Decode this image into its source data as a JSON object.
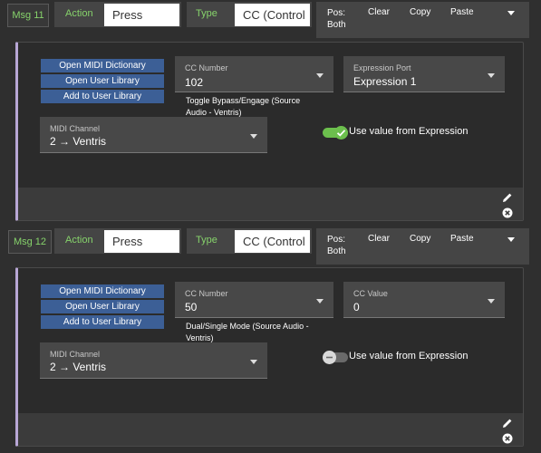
{
  "messages": [
    {
      "badge": "Msg 11",
      "action_label": "Action",
      "action_value": "Press",
      "type_label": "Type",
      "type_value": "CC (Control",
      "pos_label": "Pos:",
      "pos_value": "Both",
      "clear_label": "Clear",
      "copy_label": "Copy",
      "paste_label": "Paste",
      "library_buttons": [
        "Open MIDI Dictionary",
        "Open User Library",
        "Add to User Library"
      ],
      "cc_number_label": "CC Number",
      "cc_number_value": "102",
      "description": "Toggle Bypass/Engage (Source Audio - Ventris)",
      "second_field_label": "Expression Port",
      "second_field_value": "Expression 1",
      "midi_channel_label": "MIDI Channel",
      "midi_channel_value": "2 → Ventris",
      "toggle_label": "Use value from Expression",
      "toggle_on": true
    },
    {
      "badge": "Msg 12",
      "action_label": "Action",
      "action_value": "Press",
      "type_label": "Type",
      "type_value": "CC (Control",
      "pos_label": "Pos:",
      "pos_value": "Both",
      "clear_label": "Clear",
      "copy_label": "Copy",
      "paste_label": "Paste",
      "library_buttons": [
        "Open MIDI Dictionary",
        "Open User Library",
        "Add to User Library"
      ],
      "cc_number_label": "CC Number",
      "cc_number_value": "50",
      "description": "Dual/Single Mode (Source Audio - Ventris)",
      "second_field_label": "CC Value",
      "second_field_value": "0",
      "midi_channel_label": "MIDI Channel",
      "midi_channel_value": "2 → Ventris",
      "toggle_label": "Use value from Expression",
      "toggle_on": false
    }
  ],
  "colors": {
    "accent_green": "#86d26b",
    "toggle_on": "#6cbf4d",
    "library_button": "#3c5f96",
    "card_border_accent": "#b8a7d6"
  },
  "icons": [
    "chevron-down-icon",
    "checkmark-icon",
    "pencil-icon",
    "close-circle-icon"
  ]
}
